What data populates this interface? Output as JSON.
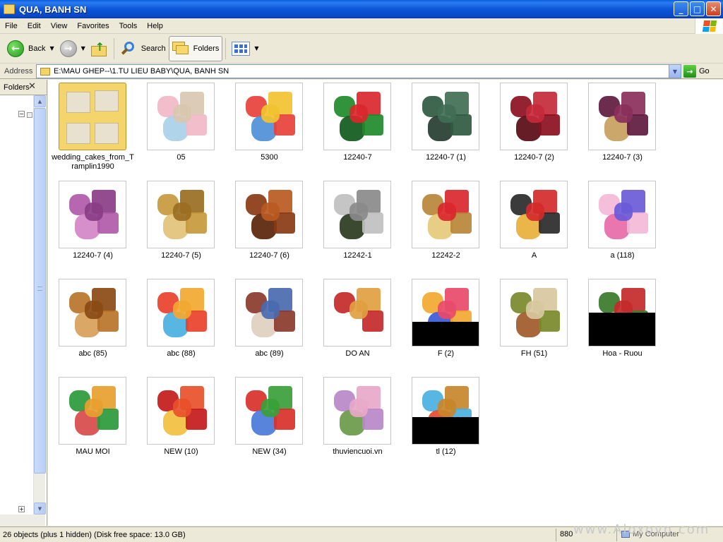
{
  "window": {
    "title": "QUA, BANH SN",
    "controls": {
      "minimize": "_",
      "maximize": "□",
      "close": "✕"
    }
  },
  "menu": [
    "File",
    "Edit",
    "View",
    "Favorites",
    "Tools",
    "Help"
  ],
  "toolbar": {
    "back_label": "Back",
    "back_icon": "←",
    "forward_icon": "→",
    "search_label": "Search",
    "folders_label": "Folders",
    "dropdown_glyph": "▼"
  },
  "address": {
    "label": "Address",
    "path": "E:\\MAU GHEP--\\1.TU LIEU BABY\\QUA, BANH SN",
    "go_label": "Go",
    "go_icon": "→"
  },
  "folders_pane": {
    "title": "Folders",
    "close_glyph": "✕",
    "collapse_glyph": "−",
    "expand_glyph": "+"
  },
  "files": [
    {
      "name": "wedding_cakes_from_Tramplin1990",
      "type": "folder",
      "colors": [
        "#f3d56b",
        "#e9e1cf"
      ]
    },
    {
      "name": "05",
      "type": "image",
      "colors": [
        "#f2b8c8",
        "#d9c7b0",
        "#a9d0e8"
      ]
    },
    {
      "name": "5300",
      "type": "image",
      "colors": [
        "#e8413b",
        "#f2c230",
        "#4f8fd8"
      ]
    },
    {
      "name": "12240-7",
      "type": "image",
      "colors": [
        "#1f8a2a",
        "#d9272d",
        "#0f5a1c"
      ]
    },
    {
      "name": "12240-7 (1)",
      "type": "image",
      "colors": [
        "#2f5a40",
        "#416e55",
        "#263d30"
      ]
    },
    {
      "name": "12240-7 (2)",
      "type": "image",
      "colors": [
        "#8b0f1e",
        "#c42a3a",
        "#5a0a12"
      ]
    },
    {
      "name": "12240-7 (3)",
      "type": "image",
      "colors": [
        "#5e1a3f",
        "#8a2f5a",
        "#c8a060"
      ]
    },
    {
      "name": "12240-7 (4)",
      "type": "image",
      "colors": [
        "#b05aa8",
        "#8a3d86",
        "#d486c8"
      ]
    },
    {
      "name": "12240-7 (5)",
      "type": "image",
      "colors": [
        "#c79a3c",
        "#9a6e22",
        "#e3c27a"
      ]
    },
    {
      "name": "12240-7 (6)",
      "type": "image",
      "colors": [
        "#8a3a14",
        "#b85a22",
        "#5a2408"
      ]
    },
    {
      "name": "12242-1",
      "type": "image",
      "colors": [
        "#c0c0c0",
        "#8a8a8a",
        "#2a3a20"
      ]
    },
    {
      "name": "12242-2",
      "type": "image",
      "colors": [
        "#b8863a",
        "#d9272d",
        "#e6c97a"
      ]
    },
    {
      "name": "A",
      "type": "image",
      "colors": [
        "#2a2a2a",
        "#d42a2a",
        "#e8b03a"
      ]
    },
    {
      "name": "a (118)",
      "type": "image",
      "colors": [
        "#f4b8d8",
        "#6a5ad8",
        "#e86aa8"
      ]
    },
    {
      "name": "abc (85)",
      "type": "image",
      "colors": [
        "#b8742a",
        "#8a4a14",
        "#d8a05a"
      ]
    },
    {
      "name": "abc (88)",
      "type": "image",
      "colors": [
        "#e8412a",
        "#f2a830",
        "#4ab0e0"
      ]
    },
    {
      "name": "abc (89)",
      "type": "image",
      "colors": [
        "#8a3a2a",
        "#4a6ab0",
        "#e0d0c0"
      ]
    },
    {
      "name": "DO AN",
      "type": "image",
      "colors": [
        "#c42a2a",
        "#e0a040",
        "#ffffff"
      ]
    },
    {
      "name": "F (2)",
      "type": "image",
      "colors": [
        "#f2a830",
        "#e84a6a",
        "#3a5ad8"
      ]
    },
    {
      "name": "FH (51)",
      "type": "image",
      "colors": [
        "#7a8a2a",
        "#d8c8a0",
        "#a05a2a"
      ]
    },
    {
      "name": "Hoa - Ruou",
      "type": "image",
      "colors": [
        "#3a7a2a",
        "#c42a2a",
        "#e8e0d0"
      ]
    },
    {
      "name": "MAU MOI",
      "type": "image",
      "colors": [
        "#2a9a3a",
        "#e8a030",
        "#d84a4a"
      ]
    },
    {
      "name": "NEW (10)",
      "type": "image",
      "colors": [
        "#c41a1a",
        "#e8502a",
        "#f2c040"
      ]
    },
    {
      "name": "NEW (34)",
      "type": "image",
      "colors": [
        "#d8302a",
        "#3aa03a",
        "#4a7ad8"
      ]
    },
    {
      "name": "thuviencuoi.vn",
      "type": "image",
      "colors": [
        "#b888c8",
        "#e8a8c8",
        "#6a9a4a"
      ]
    },
    {
      "name": "tl (12)",
      "type": "image",
      "colors": [
        "#4ab0e0",
        "#c8862a",
        "#e84a2a"
      ]
    }
  ],
  "status": {
    "objects": "26 objects (plus 1 hidden) (Disk free space: 13.0 GB)",
    "size": "880",
    "location": "My Computer"
  },
  "watermark": "www.Aloxovn.com"
}
